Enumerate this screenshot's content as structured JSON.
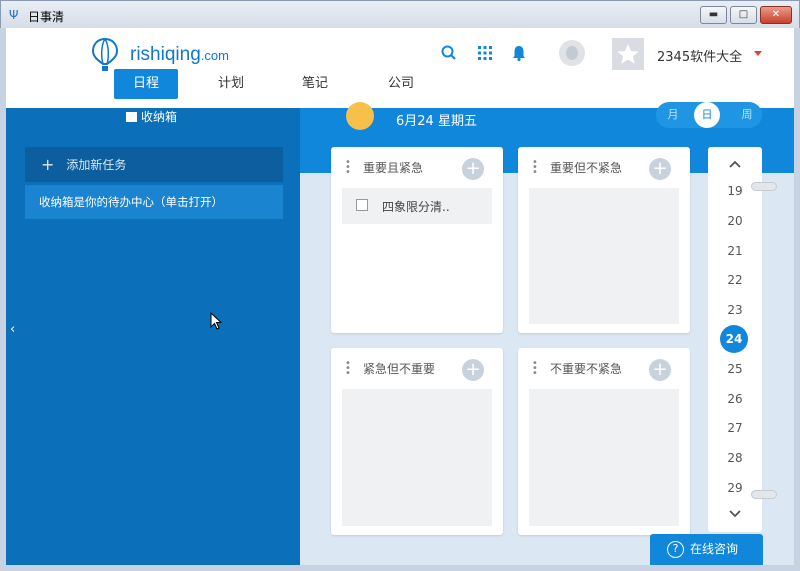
{
  "window": {
    "title": "日事清",
    "min_glyph": "▬",
    "max_glyph": "□",
    "close_glyph": "✕"
  },
  "header": {
    "logo_main": "rishiqing",
    "logo_domain": ".com",
    "username": "2345软件大全",
    "tabs": [
      "日程",
      "计划",
      "笔记",
      "公司"
    ],
    "icons": [
      "search-icon",
      "apps-grid-icon",
      "bell-icon",
      "avatar",
      "star-icon"
    ]
  },
  "left": {
    "title": "收纳箱",
    "add_task": "添加新任务",
    "hint": "收纳箱是你的待办中心（单击打开）",
    "collapse_glyph": "‹"
  },
  "main": {
    "date": "6月24 星期五",
    "views": [
      "月",
      "日",
      "周"
    ],
    "active_view": "日",
    "quadrants": [
      {
        "title": "重要且紧急",
        "tasks": [
          "四象限分清.."
        ]
      },
      {
        "title": "重要但不紧急",
        "tasks": []
      },
      {
        "title": "紧急但不重要",
        "tasks": []
      },
      {
        "title": "不重要不紧急",
        "tasks": []
      }
    ],
    "dates": [
      "19",
      "20",
      "21",
      "22",
      "23",
      "24",
      "25",
      "26",
      "27",
      "28",
      "29"
    ],
    "today": "24",
    "consult_label": "在线咨询"
  },
  "colors": {
    "brand": "#1187db",
    "left_panel": "#0b6fba",
    "close": "#c8412b"
  }
}
